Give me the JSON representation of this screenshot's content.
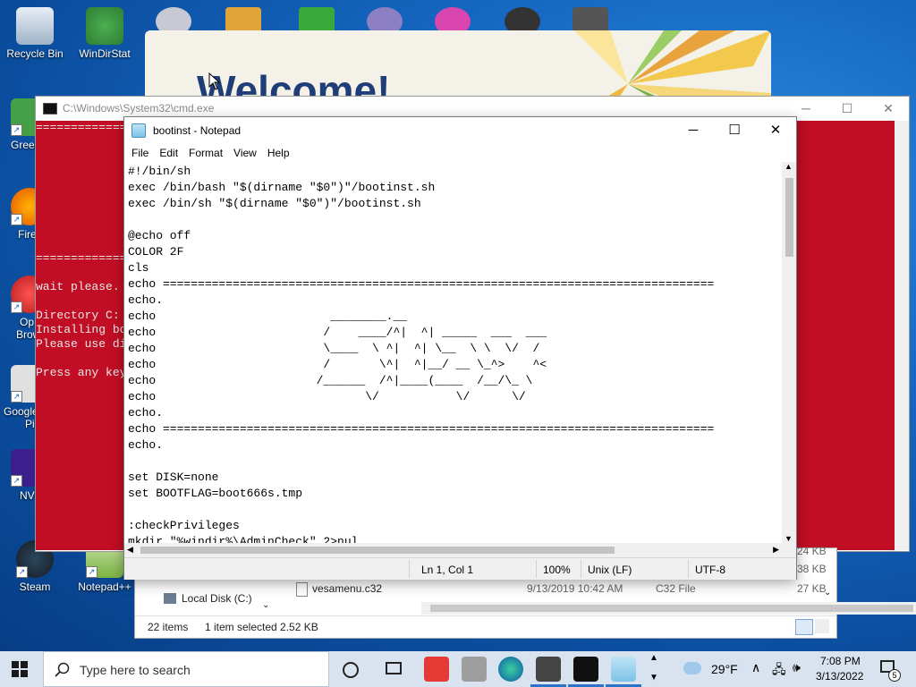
{
  "desktop": {
    "icons": [
      {
        "label": "Recycle Bin"
      },
      {
        "label": "WinDirStat"
      },
      {
        "label": "Green"
      },
      {
        "label": "Fire"
      },
      {
        "label": "Op"
      },
      {
        "label": "Brow"
      },
      {
        "label": "Google"
      },
      {
        "label": "Pi"
      },
      {
        "label": "NV"
      },
      {
        "label": "Steam"
      },
      {
        "label": "Notepad++"
      }
    ]
  },
  "welcome": {
    "title": "Welcome!"
  },
  "cmd": {
    "title": "C:\\Windows\\System32\\cmd.exe",
    "lines": [
      "=============",
      "=============",
      "wait please.",
      "Directory C:",
      "Installing bo",
      "Please use di",
      "Press any key"
    ]
  },
  "notepad": {
    "title": "bootinst - Notepad",
    "menu": [
      "File",
      "Edit",
      "Format",
      "View",
      "Help"
    ],
    "lines": [
      "#!/bin/sh",
      "exec /bin/bash \"$(dirname \"$0\")\"/bootinst.sh",
      "exec /bin/sh \"$(dirname \"$0\")\"/bootinst.sh",
      "",
      "@echo off",
      "COLOR 2F",
      "cls",
      "echo ===============================================================================",
      "echo.",
      "echo                         ________.__",
      "echo                        /    ____/^|  ^| _____  ___  ___",
      "echo                        \\____  \\ ^|  ^| \\__  \\ \\  \\/  /",
      "echo                        /       \\^|  ^|__/ __ \\_^>    ^<",
      "echo                       /______  /^|____(____  /__/\\_ \\",
      "echo                              \\/           \\/      \\/",
      "echo.",
      "echo ===============================================================================",
      "echo.",
      "",
      "set DISK=none",
      "set BOOTFLAG=boot666s.tmp",
      "",
      ":checkPrivileges",
      "mkdir \"%windir%\\AdminCheck\" 2>nul"
    ],
    "status": {
      "position": "Ln 1, Col 1",
      "zoom": "100%",
      "eol": "Unix (LF)",
      "encoding": "UTF-8"
    }
  },
  "explorer": {
    "nav_item": "Local Disk (C:)",
    "file": {
      "name": "vesamenu.c32",
      "date": "9/13/2019 10:42 AM",
      "type": "C32 File",
      "size": "27 KB"
    },
    "right_sizes": [
      "24 KB",
      "38 KB"
    ],
    "status": {
      "count": "22 items",
      "selected": "1 item selected  2.52 KB"
    }
  },
  "taskbar": {
    "search_placeholder": "Type here to search",
    "weather": "29°F",
    "time": "7:08 PM",
    "date": "3/13/2022",
    "notification_count": "5"
  },
  "colors": {
    "cmd_bg": "#c20e24",
    "taskbar": "#d9e3ef",
    "desktop": "#1668c2"
  }
}
